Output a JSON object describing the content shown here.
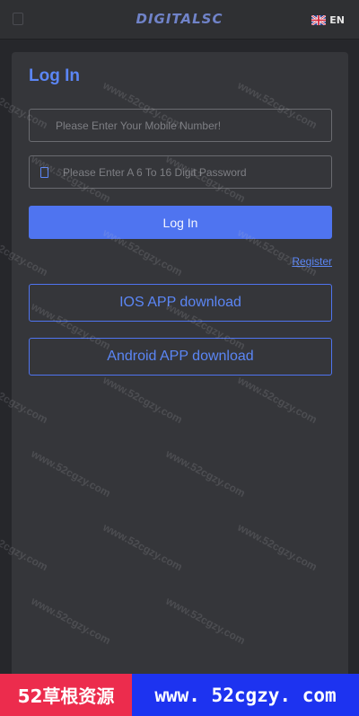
{
  "header": {
    "brand": "DIGITALSC",
    "language": "EN",
    "menu_icon": "menu-icon",
    "flag_icon": "uk-flag-icon"
  },
  "login": {
    "title": "Log In",
    "phone_placeholder": "Please Enter Your Mobile Number!",
    "password_placeholder": "Please Enter A 6 To 16 Digit Password",
    "login_button": "Log In",
    "register_link": "Register",
    "ios_download": "IOS APP download",
    "android_download": "Android APP download"
  },
  "watermark": {
    "text": "www.52cgzy.com"
  },
  "banner": {
    "left": "52草根资源",
    "right": "www. 52cgzy. com"
  },
  "colors": {
    "accent": "#4f74f0",
    "background": "#26272b",
    "panel": "#35363a",
    "banner_red": "#ec2c4d",
    "banner_blue": "#1d33f0"
  }
}
